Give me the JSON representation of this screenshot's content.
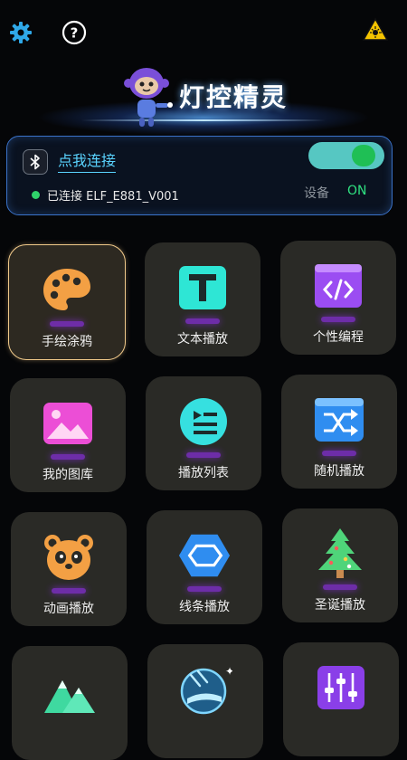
{
  "header": {
    "app_title": "灯控精灵"
  },
  "connection": {
    "connect_link": "点我连接",
    "toggle_on": true,
    "status_text": "已连接 ELF_E881_V001",
    "device_label": "设备",
    "device_state": "ON"
  },
  "grid": [
    {
      "label": "手绘涂鸦",
      "icon": "palette-icon",
      "active": true
    },
    {
      "label": "文本播放",
      "icon": "text-t-icon"
    },
    {
      "label": "个性编程",
      "icon": "code-icon"
    },
    {
      "label": "我的图库",
      "icon": "gallery-icon"
    },
    {
      "label": "播放列表",
      "icon": "playlist-icon"
    },
    {
      "label": "随机播放",
      "icon": "shuffle-icon"
    },
    {
      "label": "动画播放",
      "icon": "panda-icon"
    },
    {
      "label": "线条播放",
      "icon": "hexagon-lines-icon"
    },
    {
      "label": "圣诞播放",
      "icon": "christmas-tree-icon"
    },
    {
      "label": "",
      "icon": "mountain-icon"
    },
    {
      "label": "",
      "icon": "meteor-icon"
    },
    {
      "label": "",
      "icon": "equalizer-icon"
    }
  ],
  "colors": {
    "accent": "#5ad4ff",
    "status_green": "#2fd26a",
    "tile_bg": "#2a2a26",
    "active_border": "#f0c98a"
  }
}
